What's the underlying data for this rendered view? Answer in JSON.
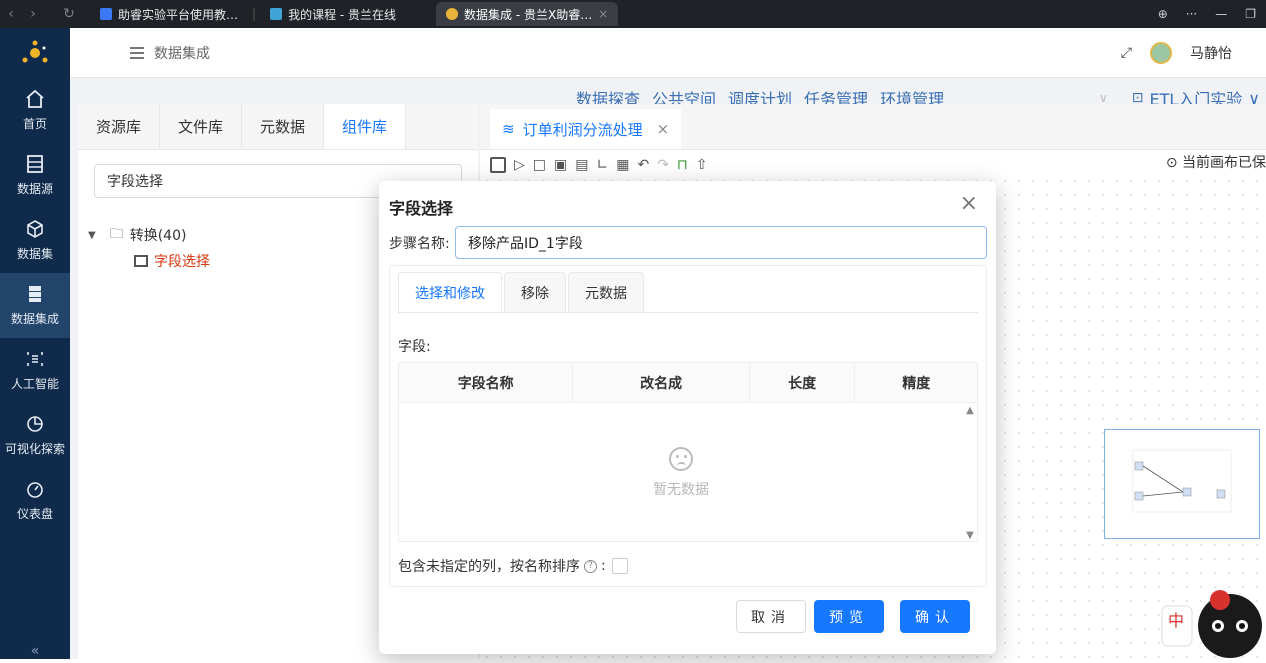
{
  "browser": {
    "tabs": [
      {
        "label": "助睿实验平台使用教…",
        "active": false
      },
      {
        "label": "我的课程 - 贵兰在线",
        "active": false
      },
      {
        "label": "数据集成 - 贵兰X助睿…",
        "active": true
      }
    ]
  },
  "sidebar": {
    "items": [
      {
        "label": "首页",
        "icon": "home-icon"
      },
      {
        "label": "数据源",
        "icon": "database-icon"
      },
      {
        "label": "数据集",
        "icon": "cube-icon"
      },
      {
        "label": "数据集成",
        "icon": "server-icon",
        "active": true
      },
      {
        "label": "人工智能",
        "icon": "ai-icon"
      },
      {
        "label": "可视化探索",
        "icon": "pie-chart-icon"
      },
      {
        "label": "仪表盘",
        "icon": "dashboard-icon"
      }
    ]
  },
  "header": {
    "title": "数据集成",
    "user_name": "马静怡"
  },
  "topnav": {
    "items": [
      "数据探查",
      "公共空间",
      "调度计划",
      "任务管理",
      "环境管理"
    ],
    "project": "ETL入门实验"
  },
  "leftpanel": {
    "tabs": [
      "资源库",
      "文件库",
      "元数据",
      "组件库"
    ],
    "active_tab": "组件库",
    "search_value": "字段选择",
    "tree": {
      "folder": "转换(40)",
      "leaf": "字段选择"
    }
  },
  "canvas": {
    "tab_label": "订单利润分流处理",
    "status": "当前画布已保"
  },
  "dialog": {
    "title": "字段选择",
    "step_label": "步骤名称:",
    "step_value": "移除产品ID_1字段",
    "tabs": [
      "选择和修改",
      "移除",
      "元数据"
    ],
    "active_tab": "选择和修改",
    "field_label": "字段:",
    "columns": [
      "字段名称",
      "改名成",
      "长度",
      "精度"
    ],
    "empty_text": "暂无数据",
    "include_label": "包含未指定的列，按名称排序",
    "include_checked": false,
    "buttons": {
      "cancel": "取消",
      "preview": "预览",
      "confirm": "确认"
    }
  },
  "colors": {
    "primary": "#1677ff",
    "sidebar_bg": "#0f2a4a",
    "nav_link": "#3a6fb5"
  }
}
